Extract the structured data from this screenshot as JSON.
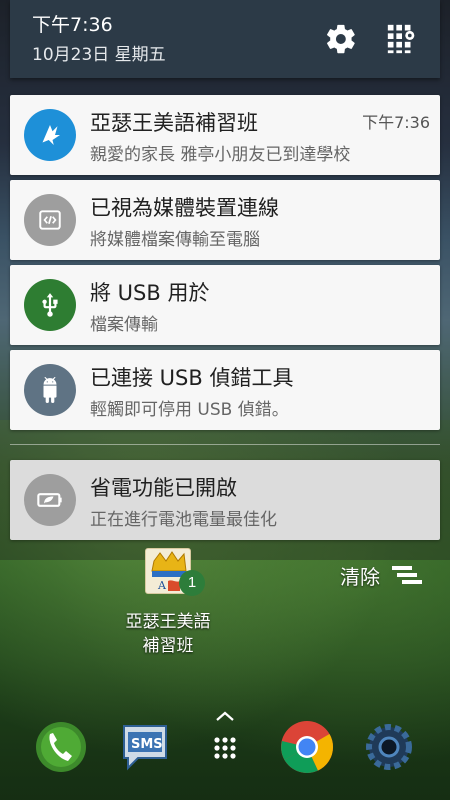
{
  "status": {
    "time": "下午7:36",
    "date": "10月23日 星期五"
  },
  "notifications": [
    {
      "title": "亞瑟王美語補習班",
      "text": "親愛的家長 雅亭小朋友已到達學校",
      "time": "下午7:36",
      "icon": "app-logo-icon",
      "icon_color": "#1e90d8"
    },
    {
      "title": "已視為媒體裝置連線",
      "text": "將媒體檔案傳輸至電腦",
      "icon": "code-icon",
      "icon_color": "#9e9e9e"
    },
    {
      "title": "將 USB 用於",
      "text": "檔案傳輸",
      "icon": "usb-icon",
      "icon_color": "#2e7d32"
    },
    {
      "title": "已連接 USB 偵錯工具",
      "text": "輕觸即可停用 USB 偵錯。",
      "icon": "android-icon",
      "icon_color": "#5f7384"
    },
    {
      "title": "省電功能已開啟",
      "text": "正在進行電池電量最佳化",
      "icon": "battery-saver-icon",
      "icon_color": "#9e9e9e"
    }
  ],
  "desktop": {
    "app_name_line1": "亞瑟王美語",
    "app_name_line2": "補習班",
    "app_badge": "1",
    "clear_label": "清除"
  },
  "dock": [
    "phone-icon",
    "sms-icon",
    "app-drawer-icon",
    "chrome-icon",
    "settings-gear-icon"
  ]
}
